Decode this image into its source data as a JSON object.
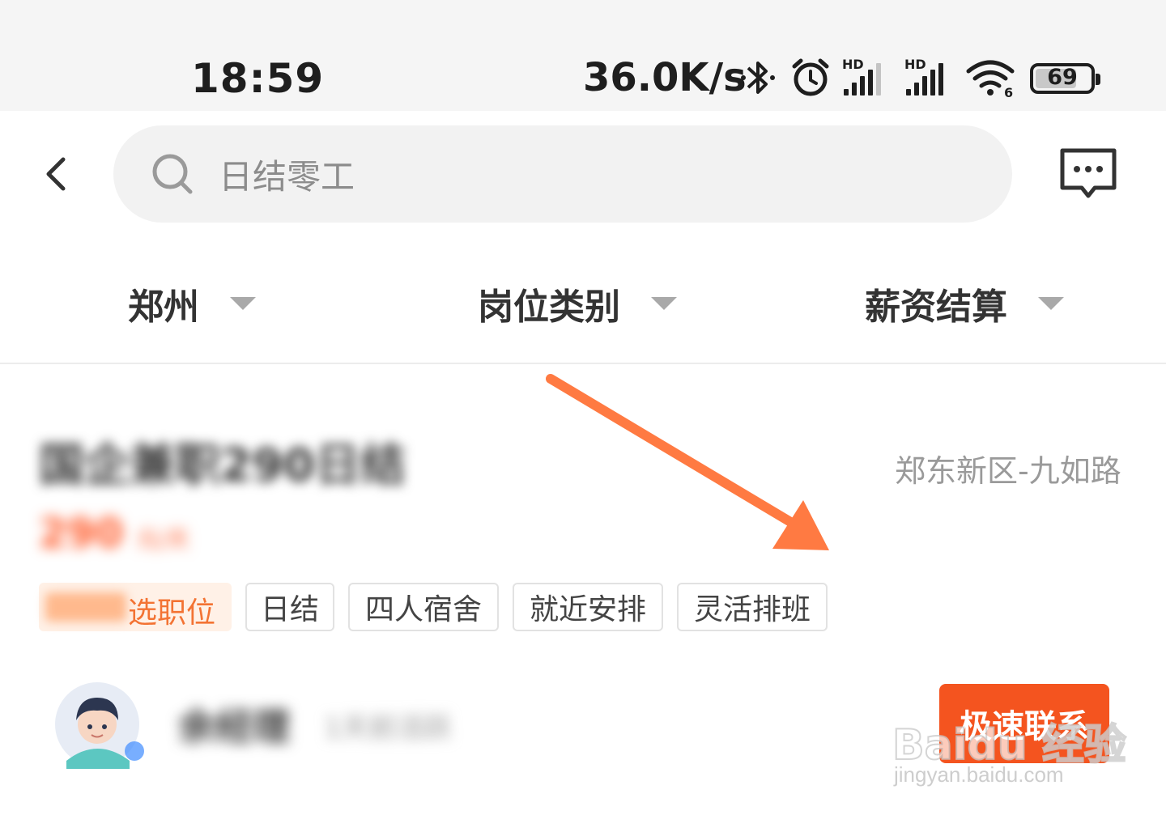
{
  "status_bar": {
    "time": "18:59",
    "network_speed": "36.0K/s",
    "hd_label_1": "HD",
    "hd_label_2": "HD",
    "wifi_badge": "6",
    "battery_level": "69",
    "battery_fraction": 0.69
  },
  "search": {
    "text": "日结零工"
  },
  "filters": [
    {
      "label": "郑州"
    },
    {
      "label": "岗位类别"
    },
    {
      "label": "薪资结算"
    }
  ],
  "job": {
    "title": "国企兼职290日结",
    "location": "郑东新区-九如路",
    "salary_value": "290",
    "salary_unit": "元/天",
    "featured_tag": "选职位",
    "tags": [
      "日结",
      "四人宿舍",
      "就近安排",
      "灵活排班"
    ]
  },
  "recruiter": {
    "name": "余经理",
    "meta": "1天前活跃",
    "contact_label": "极速联系"
  },
  "watermark": {
    "brand": "Baidu 经验",
    "url": "jingyan.baidu.com"
  },
  "colors": {
    "accent": "#f4541f",
    "arrow": "#ff7a42",
    "status_bar_bg": "#f5f5f5",
    "search_bg": "#f2f2f2"
  },
  "icons": {
    "back": "chevron-left-icon",
    "search": "search-icon",
    "message": "message-bubble-icon",
    "bluetooth": "bluetooth-icon",
    "alarm": "alarm-clock-icon",
    "signal": "signal-icon",
    "wifi": "wifi-icon",
    "battery": "battery-icon"
  }
}
